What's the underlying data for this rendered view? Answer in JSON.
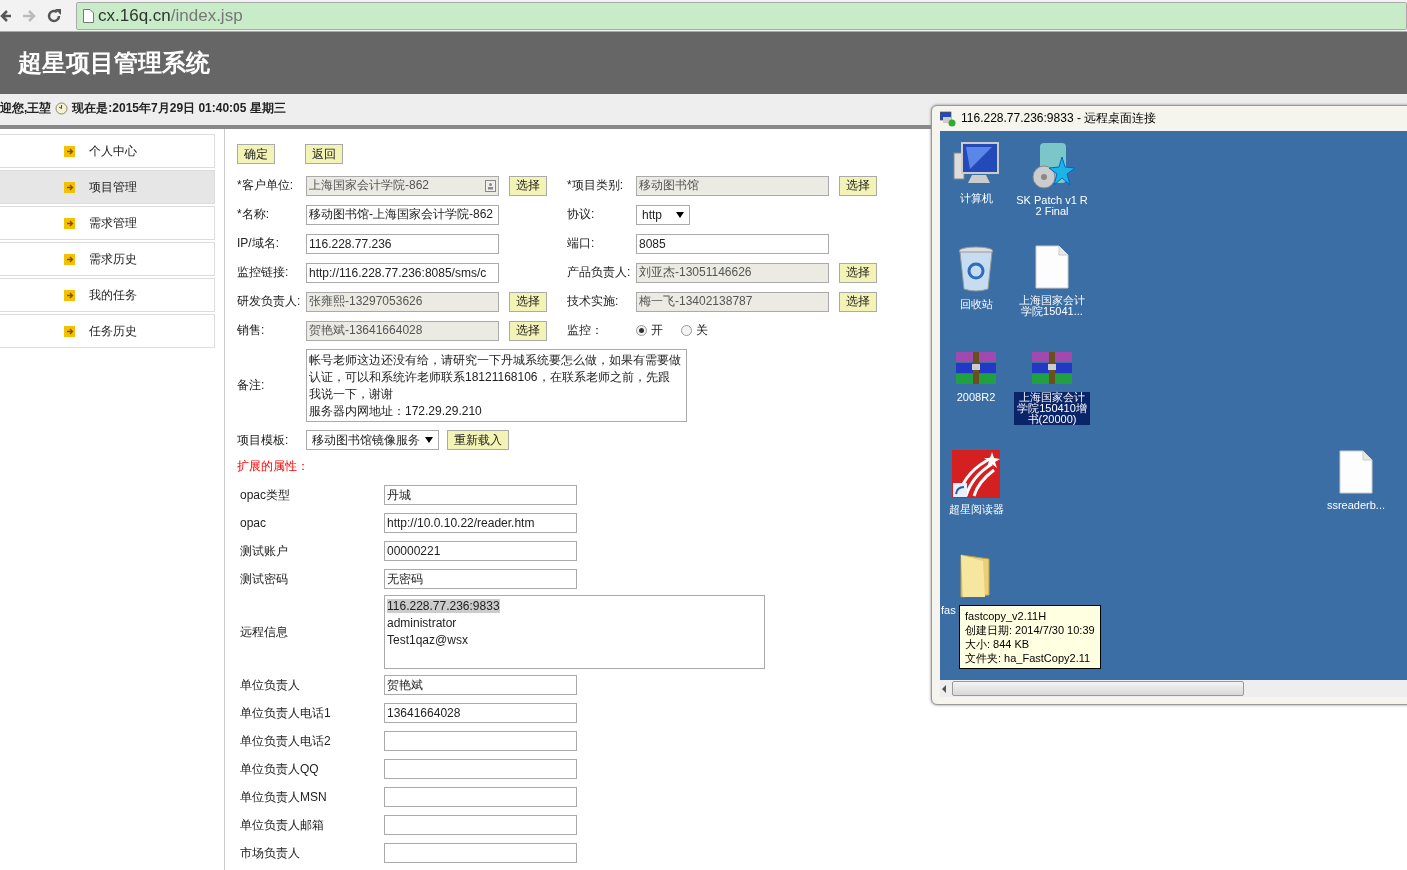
{
  "browser": {
    "url_host": "cx.16q.cn",
    "url_path": "/index.jsp"
  },
  "header": {
    "title": "超星项目管理系统"
  },
  "welcome": {
    "greeting": "迎您,王堃",
    "time": "现在是:2015年7月29日 01:40:05 星期三"
  },
  "sidebar": {
    "items": [
      {
        "label": "个人中心",
        "selected": false
      },
      {
        "label": "项目管理",
        "selected": true
      },
      {
        "label": "需求管理",
        "selected": false
      },
      {
        "label": "需求历史",
        "selected": false
      },
      {
        "label": "我的任务",
        "selected": false
      },
      {
        "label": "任务历史",
        "selected": false
      }
    ]
  },
  "actions": [
    "确定",
    "返回"
  ],
  "form": {
    "rows": [
      {
        "left": {
          "label": "*客户单位:",
          "kind": "lookup",
          "value": "上海国家会计学院-862",
          "button": "选择"
        },
        "right": {
          "label": "*项目类别:",
          "kind": "readonly",
          "value": "移动图书馆",
          "button": "选择"
        }
      },
      {
        "left": {
          "label": "*名称:",
          "kind": "text",
          "value": "移动图书馆-上海国家会计学院-862"
        },
        "right": {
          "label": "协议:",
          "kind": "select",
          "value": "http"
        }
      },
      {
        "left": {
          "label": "IP/域名:",
          "kind": "text",
          "value": "116.228.77.236"
        },
        "right": {
          "label": "端口:",
          "kind": "text",
          "value": "8085"
        }
      },
      {
        "left": {
          "label": "监控链接:",
          "kind": "text",
          "value": "http://116.228.77.236:8085/sms/c"
        },
        "right": {
          "label": "产品负责人:",
          "kind": "readonly",
          "value": "刘亚杰-13051146626",
          "button": "选择"
        }
      },
      {
        "left": {
          "label": "研发负责人:",
          "kind": "readonly",
          "value": "张雍熙-13297053626",
          "button": "选择"
        },
        "right": {
          "label": "技术实施:",
          "kind": "readonly",
          "value": "梅一飞-13402138787",
          "button": "选择"
        }
      },
      {
        "left": {
          "label": "销售:",
          "kind": "readonly",
          "value": "贺艳斌-13641664028",
          "button": "选择"
        },
        "right": {
          "label": "监控：",
          "kind": "radio",
          "options": [
            {
              "label": "开",
              "selected": true
            },
            {
              "label": "关",
              "selected": false
            }
          ]
        }
      }
    ],
    "remark": {
      "label": "备注:",
      "lines": [
        "帐号老师这边还没有给，请研究一下丹城系统要怎么做，如果有需要做",
        "认证，可以和系统许老师联系18121168106，在联系老师之前，先跟",
        "我说一下，谢谢",
        "服务器内网地址：172.29.29.210"
      ]
    },
    "template": {
      "label": "项目模板:",
      "value": "移动图书馆镜像服务",
      "button": "重新载入"
    },
    "extended_title": "扩展的属性：",
    "extended": [
      {
        "label": "opac类型",
        "kind": "text",
        "value": "丹城"
      },
      {
        "label": "opac",
        "kind": "text",
        "value": "http://10.0.10.22/reader.htm"
      },
      {
        "label": "测试账户",
        "kind": "text",
        "value": "00000221"
      },
      {
        "label": "测试密码",
        "kind": "text",
        "value": "无密码"
      },
      {
        "label": "远程信息",
        "kind": "textarea",
        "lines": [
          {
            "text": "116.228.77.236:9833",
            "selected": true
          },
          {
            "text": "administrator",
            "selected": false
          },
          {
            "text": "Test1qaz@wsx",
            "selected": false
          }
        ]
      },
      {
        "label": "单位负责人",
        "kind": "text",
        "value": "贺艳斌"
      },
      {
        "label": "单位负责人电话1",
        "kind": "text",
        "value": "13641664028"
      },
      {
        "label": "单位负责人电话2",
        "kind": "text"
      },
      {
        "label": "单位负责人QQ",
        "kind": "text"
      },
      {
        "label": "单位负责人MSN",
        "kind": "text"
      },
      {
        "label": "单位负责人邮箱",
        "kind": "text"
      },
      {
        "label": "市场负责人",
        "kind": "text"
      }
    ]
  },
  "remote_window": {
    "title": "116.228.77.236:9833 - 远程桌面连接",
    "icons": [
      {
        "label": "计算机",
        "kind": "computer",
        "selected": false
      },
      {
        "label": "SK Patch v1 R2 Final",
        "kind": "installer",
        "selected": false
      },
      {
        "label": "回收站",
        "kind": "recycle",
        "selected": false
      },
      {
        "label": "上海国家会计学院15041...",
        "kind": "file",
        "selected": false
      },
      {
        "label": "2008R2",
        "kind": "archive",
        "selected": false
      },
      {
        "label": "上海国家会计学院150410增书(20000)",
        "kind": "archive",
        "selected": true
      },
      {
        "label": "超星阅读器",
        "kind": "app",
        "selected": false
      },
      {
        "label": "ssreaderb...",
        "kind": "file",
        "selected": false
      },
      {
        "label": "fas",
        "kind": "folder",
        "selected": false
      }
    ],
    "tooltip": [
      "fastcopy_v2.11H",
      "创建日期: 2014/7/30 10:39",
      "大小: 844 KB",
      "文件夹: ha_FastCopy2.11"
    ]
  }
}
